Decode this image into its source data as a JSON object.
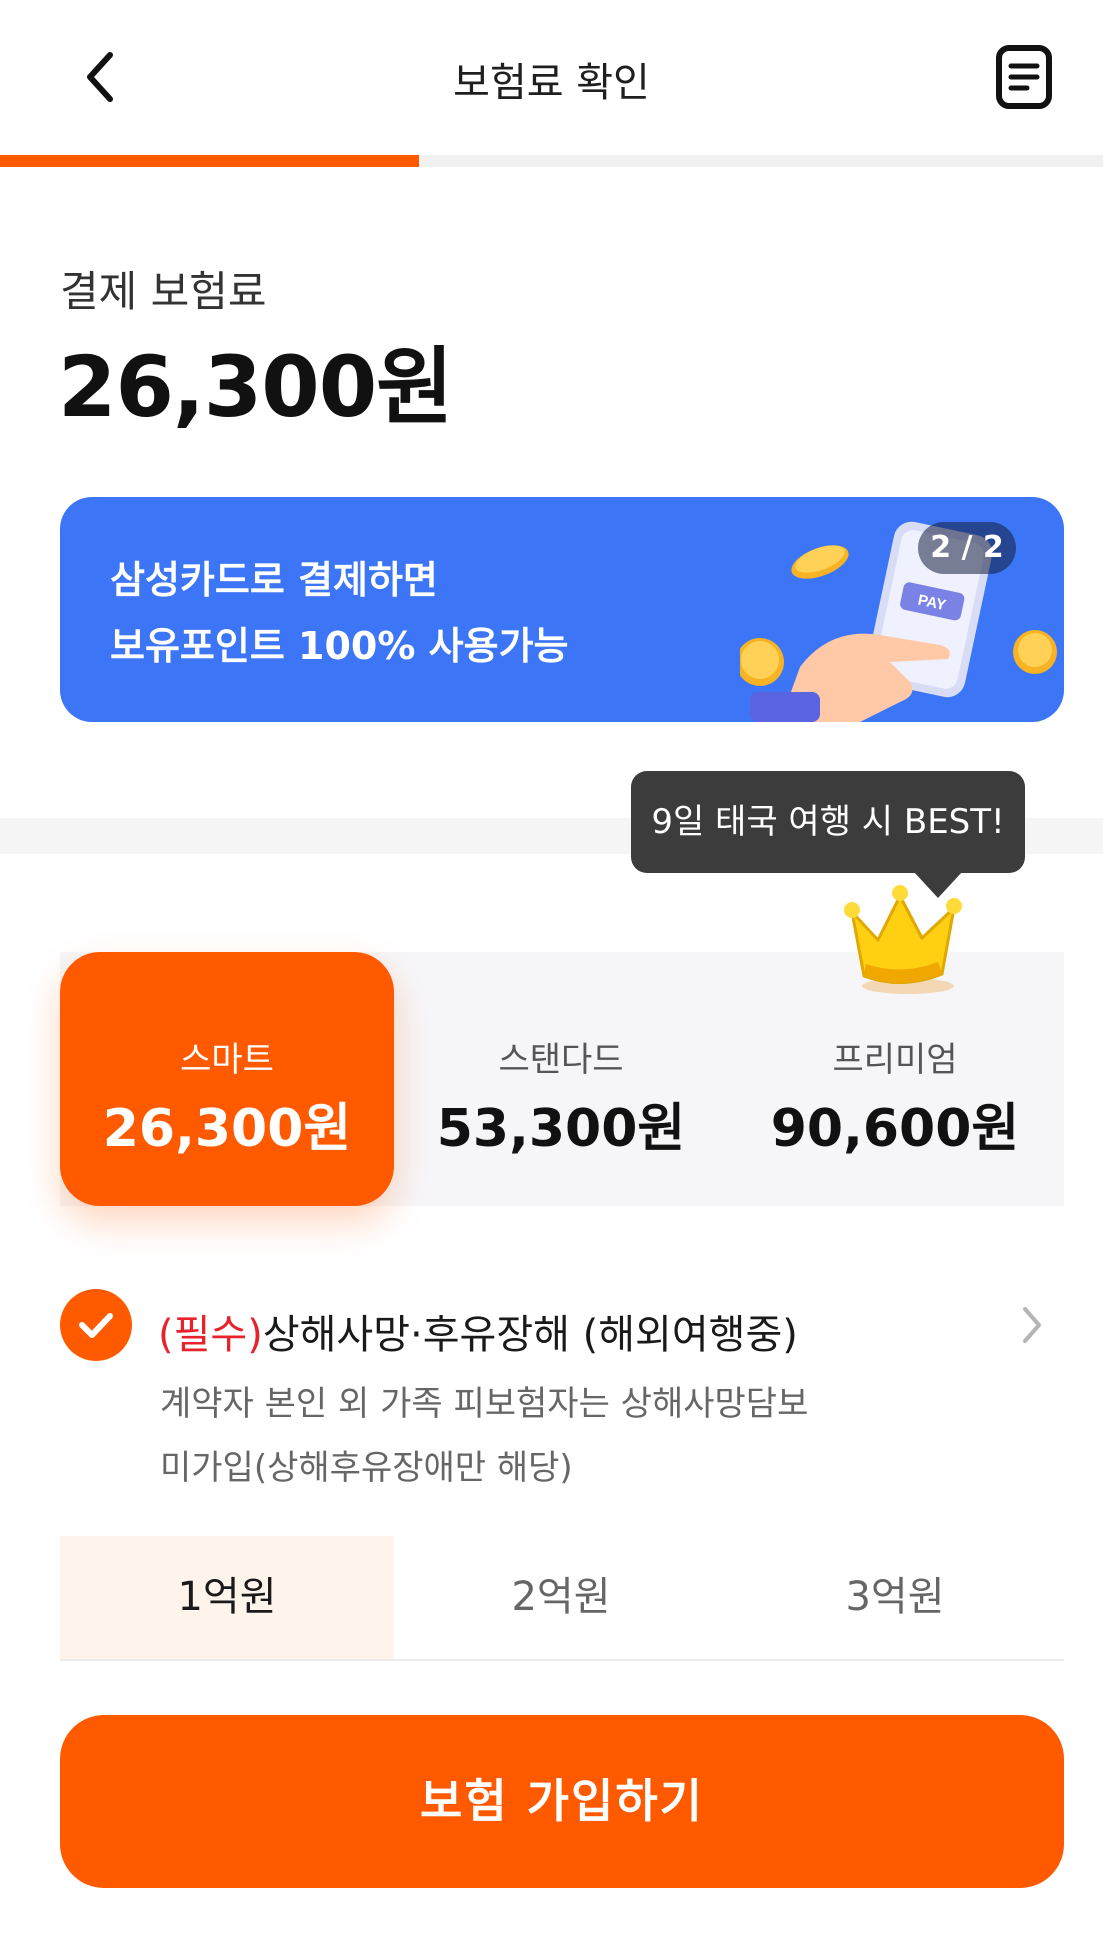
{
  "header": {
    "title": "보험료 확인",
    "back_icon": "chevron-left-icon",
    "document_icon": "document-list-icon",
    "progress": 0.38
  },
  "premium": {
    "label": "결제 보험료",
    "amount": "26,300원"
  },
  "banner": {
    "line1": "삼성카드로 결제하면",
    "line2": "보유포인트 100% 사용가능",
    "pager": "2 / 2",
    "pay_label": "PAY",
    "color": "#3d75f7"
  },
  "tooltip": {
    "text": "9일 태국 여행 시 BEST!"
  },
  "plans": [
    {
      "name": "스마트",
      "price": "26,300원",
      "selected": true
    },
    {
      "name": "스탠다드",
      "price": "53,300원",
      "selected": false
    },
    {
      "name": "프리미엄",
      "price": "90,600원",
      "selected": false
    }
  ],
  "coverage": {
    "required_label": "(필수)",
    "title": "상해사망·후유장해 (해외여행중)",
    "desc_line1": "계약자 본인 외 가족 피보험자는 상해사망담보",
    "desc_line2": "미가입(상해후유장애만 해당)"
  },
  "amounts": [
    {
      "label": "1억원",
      "selected": true
    },
    {
      "label": "2억원",
      "selected": false
    },
    {
      "label": "3억원",
      "selected": false
    }
  ],
  "cta": {
    "label": "보험 가입하기"
  },
  "colors": {
    "accent": "#ff5a00",
    "required": "#e8222b"
  }
}
